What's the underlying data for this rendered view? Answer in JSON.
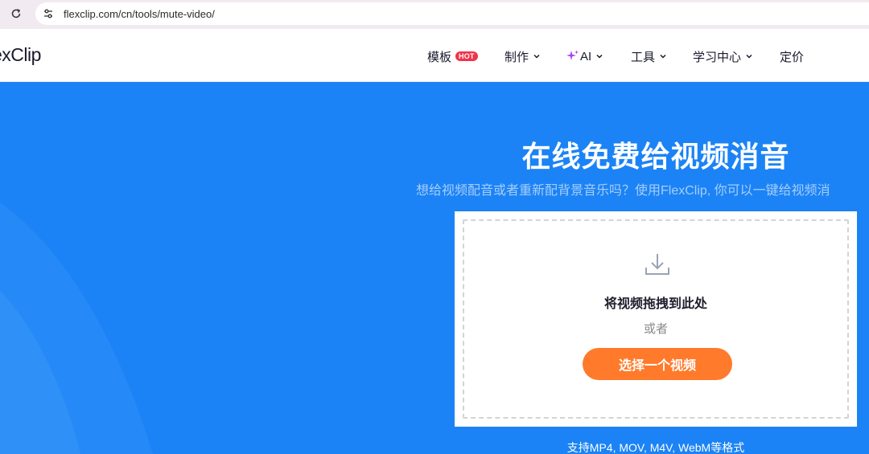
{
  "browser": {
    "url": "flexclip.com/cn/tools/mute-video/"
  },
  "nav": {
    "logo": "exClip",
    "items": [
      {
        "label": "模板",
        "badge": "HOT"
      },
      {
        "label": "制作"
      },
      {
        "label": "AI"
      },
      {
        "label": "工具"
      },
      {
        "label": "学习中心"
      },
      {
        "label": "定价"
      }
    ]
  },
  "hero": {
    "title": "在线免费给视频消音",
    "subtitle": "想给视频配音或者重新配背景音乐吗？使用FlexClip, 你可以一键给视频消",
    "upload": {
      "drop_label": "将视频拖拽到此处",
      "or_label": "或者",
      "button_label": "选择一个视频"
    },
    "formats": "支持MP4, MOV, M4V, WebM等格式"
  },
  "colors": {
    "hero_bg": "#1b83f5",
    "button": "#ff7a2a",
    "badge": "#f0344a",
    "ai_sparkle": "#a546f5"
  }
}
